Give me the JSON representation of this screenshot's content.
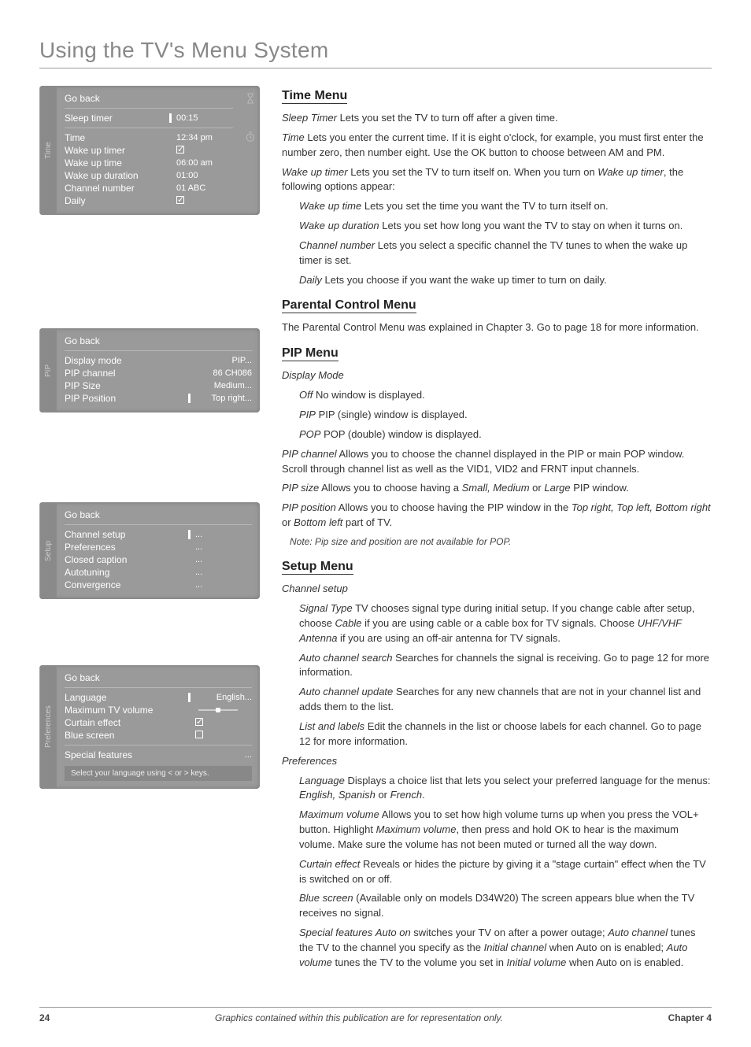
{
  "page": {
    "title": "Using the TV's Menu System",
    "number": "24",
    "footerNote": "Graphics contained within this publication are for representation only.",
    "chapter": "Chapter 4"
  },
  "osd_time": {
    "tag": "Time",
    "goBack": "Go back",
    "rows": [
      {
        "label": "Sleep timer",
        "value": "00:15",
        "bar": true
      },
      {
        "label": "Time",
        "value": "12:34 pm"
      },
      {
        "label": "Wake up timer",
        "value": "",
        "check": true
      },
      {
        "label": "Wake up time",
        "value": "06:00 am"
      },
      {
        "label": "Wake up duration",
        "value": "01:00"
      },
      {
        "label": "Channel number",
        "value": "01 ABC"
      },
      {
        "label": "Daily",
        "value": "",
        "check": true
      }
    ]
  },
  "osd_pip": {
    "tag": "PIP",
    "goBack": "Go back",
    "rows": [
      {
        "label": "Display mode",
        "value": "PIP..."
      },
      {
        "label": "PIP channel",
        "value": "86  CH086"
      },
      {
        "label": "PIP Size",
        "value": "Medium..."
      },
      {
        "label": "PIP Position",
        "value": "Top right...",
        "bar": true
      }
    ]
  },
  "osd_setup": {
    "tag": "Setup",
    "goBack": "Go back",
    "rows": [
      {
        "label": "Channel setup",
        "value": "...",
        "bar": true
      },
      {
        "label": "Preferences",
        "value": "..."
      },
      {
        "label": "Closed caption",
        "value": "..."
      },
      {
        "label": "Autotuning",
        "value": "..."
      },
      {
        "label": "Convergence",
        "value": "..."
      }
    ]
  },
  "osd_pref": {
    "tag": "Preferences",
    "goBack": "Go back",
    "rows": [
      {
        "label": "Language",
        "value": "English...",
        "bar": true,
        "slider": true
      },
      {
        "label": "Maximum TV volume",
        "value": ""
      },
      {
        "label": "Curtain effect",
        "value": "",
        "check": true
      },
      {
        "label": "Blue screen",
        "value": "",
        "checkempty": true
      },
      {
        "label": "Special features",
        "value": "..."
      }
    ],
    "hint": "Select your language using < or > keys."
  },
  "sections": {
    "time": {
      "heading": "Time Menu",
      "p1a": "Sleep Timer",
      "p1b": "   Lets you set the TV to turn off after a given time.",
      "p2a": "Time",
      "p2b": "   Lets you enter the current time. If it is eight o'clock, for example, you must first enter the number zero, then number eight. Use the OK button to choose between AM and PM.",
      "p3a": "Wake up timer",
      "p3b": "   Lets you set the TV to turn itself on. When you turn on ",
      "p3c": "Wake up timer",
      "p3d": ", the following options appear:",
      "sub1a": "Wake up time",
      "sub1b": "   Lets you set the time you want the TV to turn itself on.",
      "sub2a": "Wake up duration",
      "sub2b": "   Lets you set how long you want the TV to stay on when it turns on.",
      "sub3a": "Channel number",
      "sub3b": "   Lets you select a specific channel the TV tunes to when the wake up timer is set.",
      "sub4a": "Daily",
      "sub4b": "    Lets you choose if you want the wake up timer to turn on daily."
    },
    "parental": {
      "heading": "Parental Control Menu",
      "p": "The Parental Control Menu was explained in Chapter 3. Go to page 18 for more information."
    },
    "pip": {
      "heading": "PIP Menu",
      "dm": "Display Mode",
      "off_a": "Off",
      "off_b": "   No window is displayed.",
      "pip_a": "PIP",
      "pip_b": "   PIP (single) window is displayed.",
      "pop_a": "POP",
      "pop_b": "   POP (double) window is displayed.",
      "ch_a": "PIP channel",
      "ch_b": "    Allows you to choose the channel displayed in the PIP or main POP window. Scroll through channel list as well as the VID1, VID2 and FRNT input channels.",
      "sz_a": "PIP size",
      "sz_b": "    Allows you to choose having a ",
      "sz_c": "Small, Medium",
      "sz_d": " or ",
      "sz_e": "Large",
      "sz_f": " PIP window.",
      "ps_a": "PIP position",
      "ps_b": "    Allows you to choose having the PIP window in the ",
      "ps_c": "Top right, Top left, Bottom right",
      "ps_d": " or ",
      "ps_e": "Bottom left",
      "ps_f": " part of TV.",
      "note": "Note: Pip size and position are not available for POP."
    },
    "setup": {
      "heading": "Setup Menu",
      "cs": "Channel setup",
      "st_a": "Signal Type",
      "st_b": "   TV chooses signal type during initial setup. If you change cable after setup, choose ",
      "st_c": "Cable",
      "st_d": " if you are using cable or a cable box for TV signals. Choose ",
      "st_e": "UHF/VHF Antenna",
      "st_f": " if you are using an off-air antenna for TV signals.",
      "acs_a": "Auto channel search",
      "acs_b": "    Searches for channels the signal is receiving. Go to page 12 for more information.",
      "acu_a": "Auto channel update",
      "acu_b": "    Searches for any new channels that are not in your channel list and adds them to the list.",
      "ll_a": "List and labels",
      "ll_b": "    Edit the channels in the list or choose labels for each channel. Go to page 12 for more information.",
      "pr": "Preferences",
      "lg_a": "Language",
      "lg_b": "   Displays a choice list that lets you select your preferred language for the menus: ",
      "lg_c": "English, Spanish",
      "lg_d": " or ",
      "lg_e": "French",
      "lg_f": ".",
      "mv_a": "Maximum volume",
      "mv_b": "   Allows you to set how high volume turns up when you press the VOL+ button.  Highlight ",
      "mv_c": "Maximum volume",
      "mv_d": ", then press and hold OK to hear is the maximum volume. Make sure the volume has not been muted or turned all the way down.",
      "ce_a": "Curtain effect",
      "ce_b": "    Reveals or hides the picture by giving it a \"stage curtain\" effect when the TV is switched on or off.",
      "bs_a": "Blue screen",
      "bs_b": " (Available only on models D34W20)    The screen appears blue when the TV receives no signal.",
      "sf_a": "Special features",
      "sf_b": "    ",
      "sf_c": "Auto on",
      "sf_d": " switches your TV on after a power outage; ",
      "sf_e": "Auto channel",
      "sf_f": " tunes the TV to the channel you specify as the ",
      "sf_g": "Initial channel",
      "sf_h": " when Auto on is enabled; ",
      "sf_i": "Auto volume",
      "sf_j": " tunes the TV to the volume you set in ",
      "sf_k": "Initial volume",
      "sf_l": " when Auto on is enabled."
    }
  }
}
